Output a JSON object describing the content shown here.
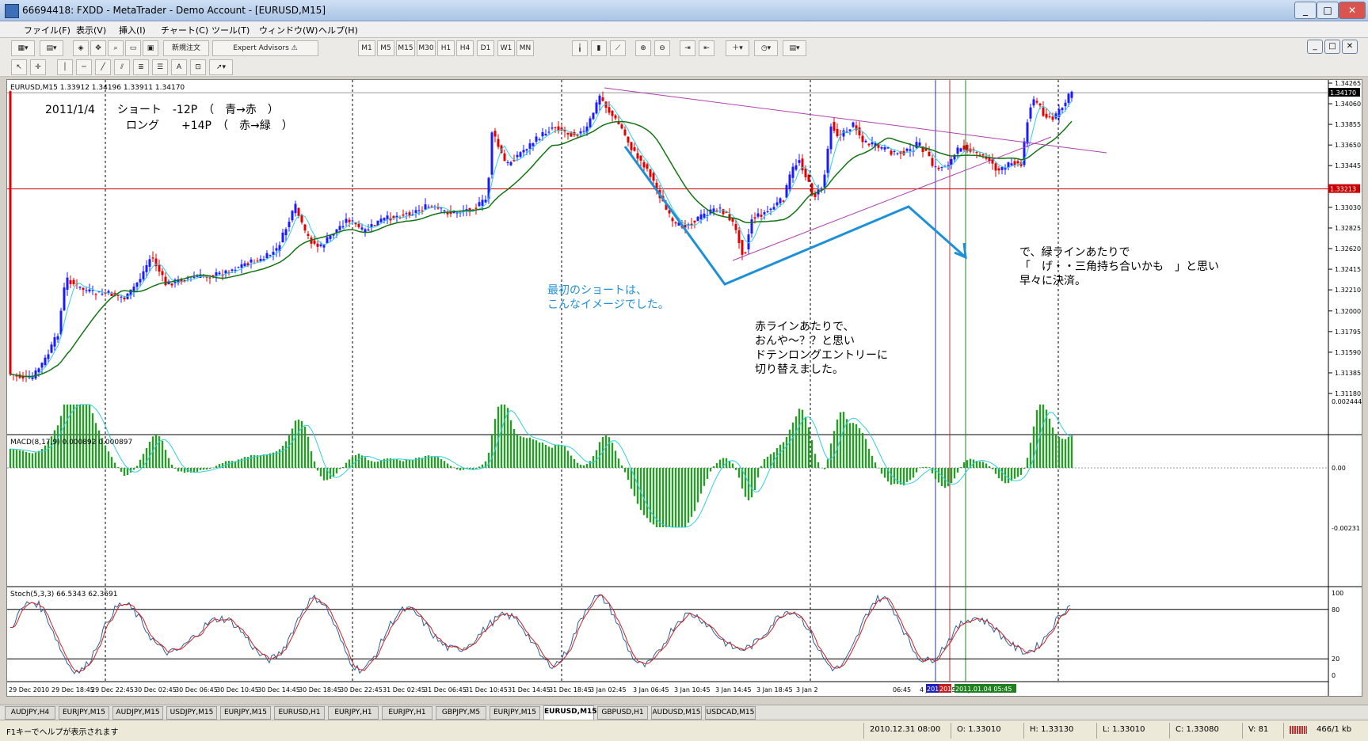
{
  "window": {
    "title": "66694418: FXDD - MetaTrader - Demo Account - [EURUSD,M15]"
  },
  "menu": [
    "ファイル(F)",
    "表示(V)",
    "挿入(I)",
    "チャート(C)",
    "ツール(T)",
    "ウィンドウ(W)",
    "ヘルプ(H)"
  ],
  "toolbar": {
    "new_order": "新規注文",
    "expert_advisors": "Expert Advisors",
    "periods": [
      "M1",
      "M5",
      "M15",
      "M30",
      "H1",
      "H4",
      "D1",
      "W1",
      "MN"
    ]
  },
  "chart": {
    "info": "EURUSD,M15  1.33912 1.34196 1.33911 1.34170",
    "notes": {
      "header1": "2011/1/4　　ショート　-12P　（　青→赤　）",
      "header2": "ロング　　+14P　（　赤→緑　）",
      "blue1": "最初のショートは、",
      "blue2": "こんなイメージでした。",
      "mid1": "赤ラインあたりで、",
      "mid2": "おんや～？？と思い",
      "mid3": "ドテンロングエントリーに",
      "mid4": "切り替えました。",
      "right1": "で、緑ラインあたりで",
      "right2": "「　げ・・三角持ち合いかも　」と思い",
      "right3": "早々に決済。"
    },
    "price_ticks": [
      "1.34265",
      "1.34060",
      "1.33855",
      "1.33650",
      "1.33445",
      "1.33030",
      "1.32825",
      "1.32620",
      "1.32415",
      "1.32210",
      "1.32000",
      "1.31795",
      "1.31590",
      "1.31385",
      "1.31180"
    ],
    "price_current": "1.34170",
    "price_red": "1.33213",
    "macd_label": "MACD(8,17,9) 0.000892 0.000897",
    "macd_ticks": [
      "0.002444",
      "0.00",
      "-0.00231"
    ],
    "stoch_label": "Stoch(5,3,3) 66.5343 62.3691",
    "stoch_ticks": [
      "100",
      "80",
      "20",
      "0"
    ],
    "time_ticks": [
      "29 Dec 2010",
      "29 Dec 18:45",
      "29 Dec 22:45",
      "30 Dec 02:45",
      "30 Dec 06:45",
      "30 Dec 10:45",
      "30 Dec 14:45",
      "30 Dec 18:45",
      "30 Dec 22:45",
      "31 Dec 02:45",
      "31 Dec 06:45",
      "31 Dec 10:45",
      "31 Dec 14:45",
      "31 Dec 18:45",
      "3 Jan 02:45",
      "3 Jan 06:45",
      "3 Jan 10:45",
      "3 Jan 14:45",
      "3 Jan 18:45",
      "3 Jan 2",
      "06:45",
      "4 Jan 10:45",
      "4 Jan 14:45"
    ],
    "time_markers": {
      "blue": "201",
      "red": "201",
      "green": "2011.01.04 05:45"
    }
  },
  "tabs": [
    "AUDJPY,H4",
    "EURJPY,M15",
    "AUDJPY,M15",
    "USDJPY,M15",
    "EURJPY,M15",
    "EURUSD,H1",
    "EURJPY,H1",
    "EURJPY,H1",
    "GBPJPY,M5",
    "EURJPY,M15",
    "EURUSD,M15",
    "GBPUSD,H1",
    "AUDUSD,M15",
    "USDCAD,M15"
  ],
  "active_tab": "EURUSD,M15",
  "status": {
    "help": "F1キーでヘルプが表示されます",
    "datetime": "2010.12.31 08:00",
    "open": "O: 1.33010",
    "high": "H: 1.33130",
    "low": "L: 1.33010",
    "close": "C: 1.33080",
    "volume": "V: 81",
    "traffic": "466/1 kb"
  },
  "colors": {
    "blue_line": "#1e90d8",
    "candle_up": "#1a1aff",
    "candle_down": "#e00000",
    "ma_fast": "#2fd0e0",
    "ma_slow": "#127512",
    "macd_hist": "#2a9a2a",
    "red_level": "#cc0000",
    "triangle": "#b040b0"
  }
}
